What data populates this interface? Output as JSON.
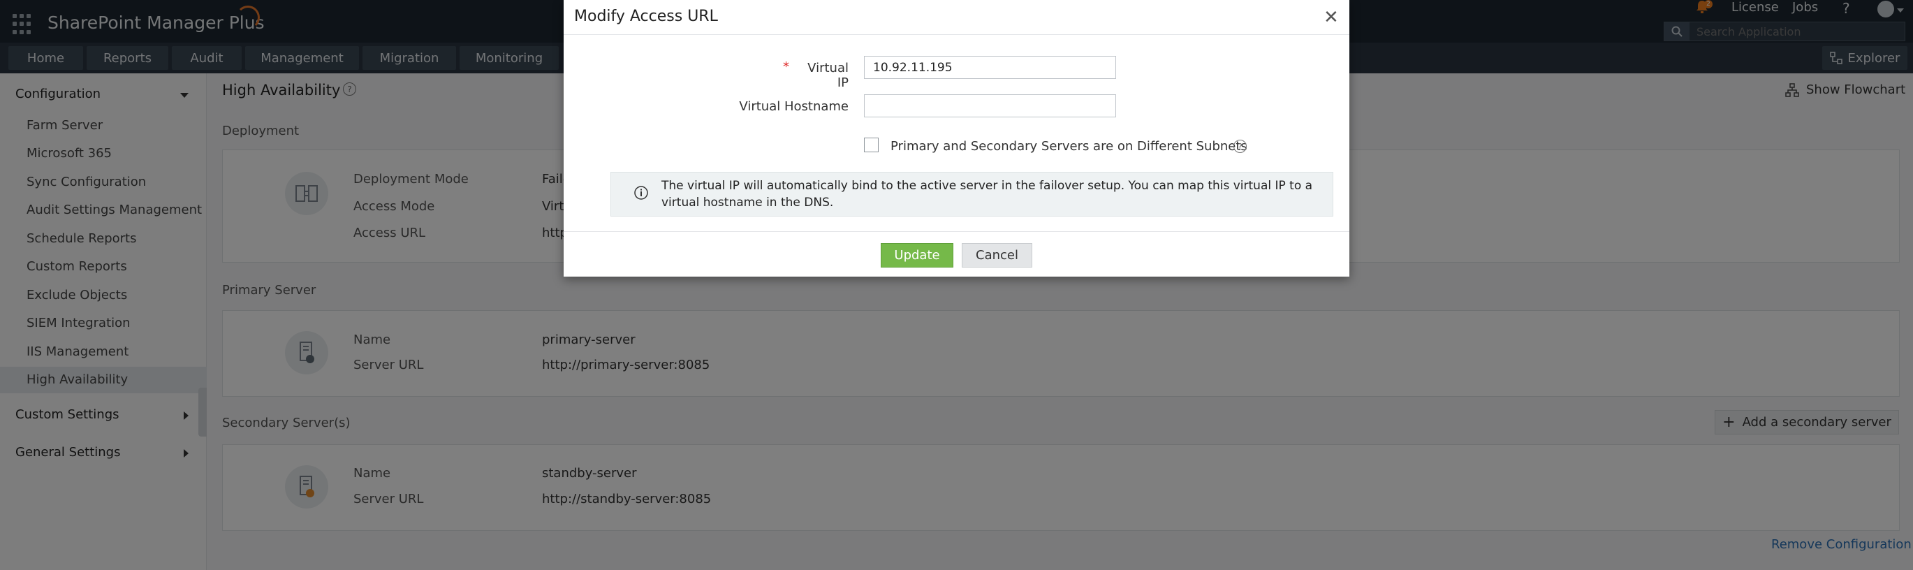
{
  "app": {
    "title": "SharePoint Manager Plus"
  },
  "nav": {
    "tabs": [
      "Home",
      "Reports",
      "Audit",
      "Management",
      "Migration",
      "Monitoring"
    ],
    "explorer": "Explorer"
  },
  "topright": {
    "notif_count": "2",
    "license": "License",
    "jobs": "Jobs",
    "help": "?"
  },
  "search": {
    "placeholder": "Search Application"
  },
  "sidebar": {
    "configuration": "Configuration",
    "items": [
      "Farm Server",
      "Microsoft 365",
      "Sync Configuration",
      "Audit Settings Management",
      "Schedule Reports",
      "Custom Reports",
      "Exclude Objects",
      "SIEM Integration",
      "IIS Management",
      "High Availability"
    ],
    "custom_settings": "Custom Settings",
    "general_settings": "General Settings"
  },
  "page": {
    "title": "High Availability",
    "show_flowchart": "Show Flowchart",
    "deployment": {
      "title": "Deployment",
      "mode_label": "Deployment Mode",
      "mode_value": "Failo",
      "access_label": "Access Mode",
      "access_value": "Virt",
      "url_label": "Access URL",
      "url_value": "http"
    },
    "primary": {
      "title": "Primary Server",
      "name_label": "Name",
      "name_value": "primary-server",
      "url_label": "Server URL",
      "url_value": "http://primary-server:8085"
    },
    "secondary": {
      "title": "Secondary Server(s)",
      "add_button": "Add a secondary server",
      "name_label": "Name",
      "name_value": "standby-server",
      "url_label": "Server URL",
      "url_value": "http://standby-server:8085"
    },
    "remove_config": "Remove Configuration"
  },
  "modal": {
    "title": "Modify Access URL",
    "required_mark": "*",
    "vip_label": "Virtual IP",
    "vip_value": "10.92.11.195",
    "hostname_label": "Virtual Hostname",
    "hostname_value": "",
    "checkbox_label": "Primary and Secondary Servers are on Different Subnets",
    "info_line1": "The virtual IP will automatically bind to the active server in the failover setup. You can map this virtual IP to a",
    "info_line2": "virtual hostname in the DNS.",
    "update": "Update",
    "cancel": "Cancel",
    "help_glyph": "?"
  },
  "colors": {
    "accent_green": "#75b949",
    "topbar": "#1d2731",
    "link_blue": "#2b6fb4",
    "notif_orange": "#f07f1e"
  }
}
